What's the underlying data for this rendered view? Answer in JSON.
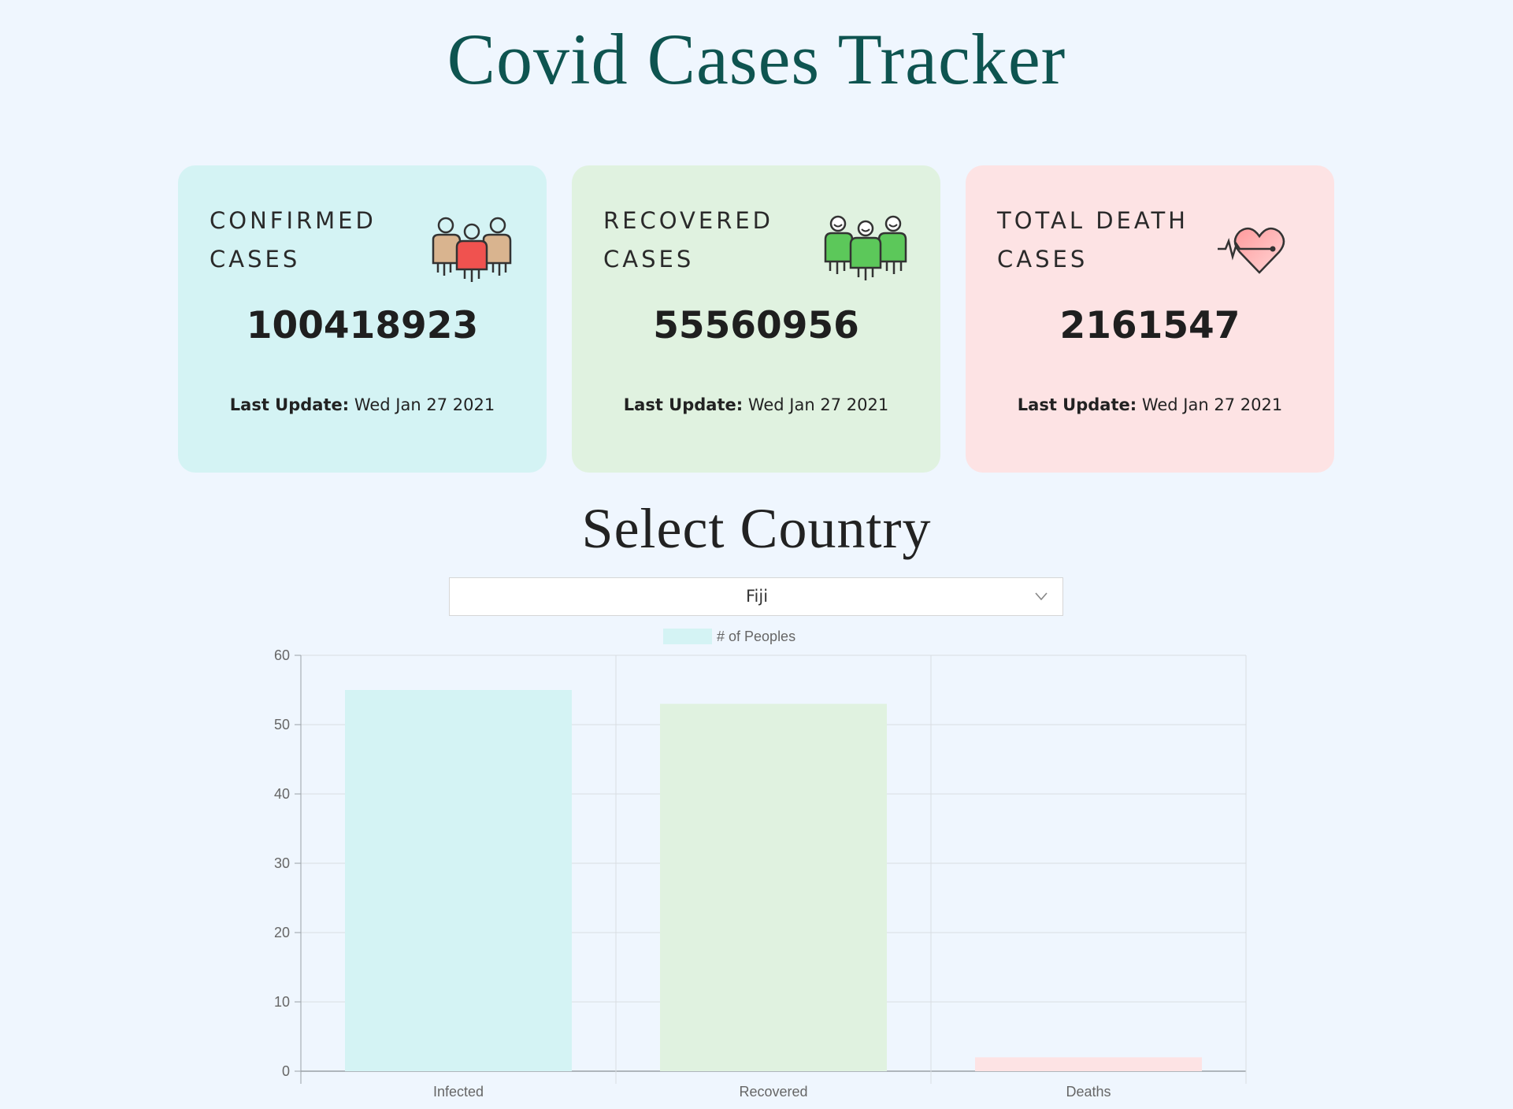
{
  "header": {
    "title": "Covid Cases Tracker"
  },
  "cards": [
    {
      "id": "confirmed",
      "title_line1": "CONFIRMED",
      "title_line2": "CASES",
      "value": "100418923",
      "update_label": "Last Update:",
      "update_value": "Wed Jan 27 2021",
      "icon": "people-group-icon",
      "bg": "#d4f3f4"
    },
    {
      "id": "recovered",
      "title_line1": "RECOVERED",
      "title_line2": "CASES",
      "value": "55560956",
      "update_label": "Last Update:",
      "update_value": "Wed Jan 27 2021",
      "icon": "smiling-people-icon",
      "bg": "#e0f2e0"
    },
    {
      "id": "deaths",
      "title_line1": "TOTAL DEATH",
      "title_line2": "CASES",
      "value": "2161547",
      "update_label": "Last Update:",
      "update_value": "Wed Jan 27 2021",
      "icon": "heartbeat-icon",
      "bg": "#fde3e4"
    }
  ],
  "country_section": {
    "heading": "Select Country",
    "selected": "Fiji"
  },
  "chart_data": {
    "type": "bar",
    "categories": [
      "Infected",
      "Recovered",
      "Deaths"
    ],
    "series": [
      {
        "name": "# of Peoples",
        "values": [
          55,
          53,
          2
        ]
      }
    ],
    "bar_colors": [
      "#d4f3f4",
      "#e0f2e0",
      "#fde3e4"
    ],
    "legend_color": "#d4f3f4",
    "ylim": [
      0,
      60
    ],
    "yticks": [
      0,
      10,
      20,
      30,
      40,
      50,
      60
    ],
    "grid": true,
    "legend_position": "top"
  }
}
